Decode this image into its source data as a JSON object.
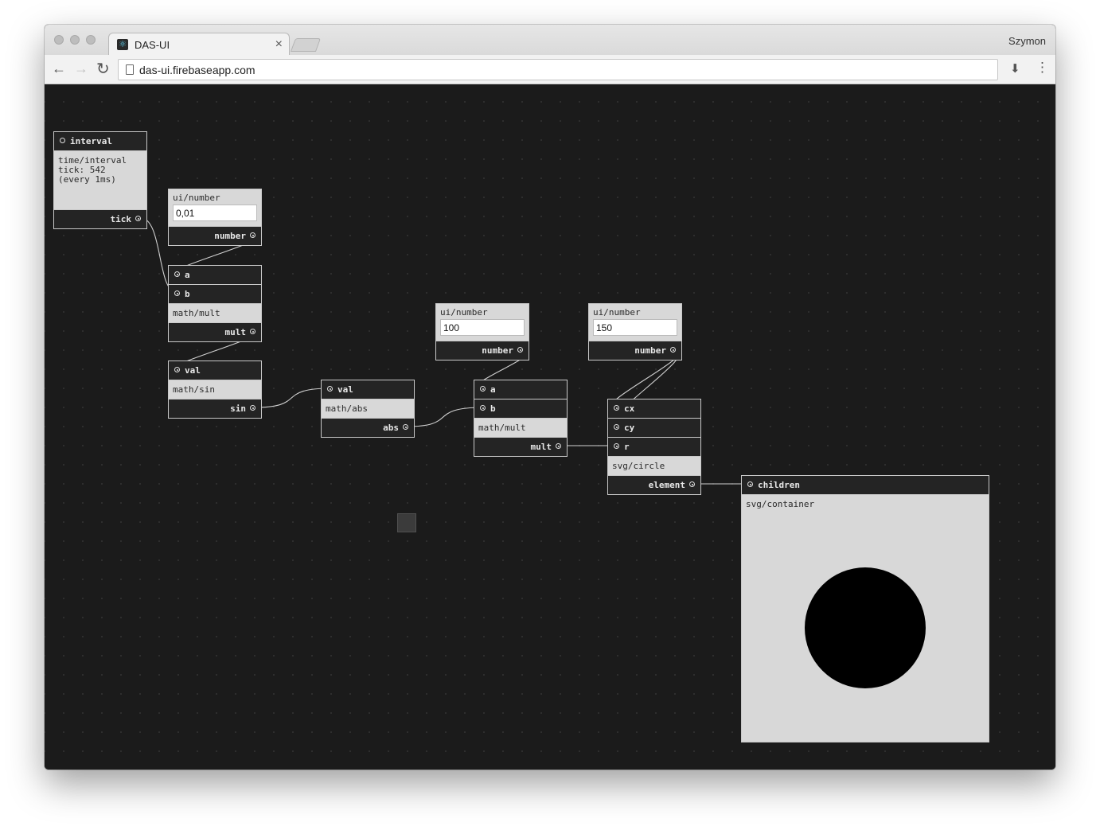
{
  "browser": {
    "tab_title": "DAS-UI",
    "tab_close": "×",
    "profile": "Szymon",
    "url": "das-ui.firebaseapp.com",
    "back": "←",
    "forward": "→",
    "reload": "↻",
    "download": "⬇",
    "menu": "⋮"
  },
  "nodes": {
    "interval": {
      "title": "interval",
      "type": "time/interval",
      "tick_text": "tick: 542",
      "every_text": "(every 1ms)",
      "out": "tick"
    },
    "number1": {
      "type": "ui/number",
      "value": "0,01",
      "out": "number"
    },
    "mult1": {
      "in_a": "a",
      "in_b": "b",
      "type": "math/mult",
      "out": "mult"
    },
    "sin": {
      "in": "val",
      "type": "math/sin",
      "out": "sin"
    },
    "abs": {
      "in": "val",
      "type": "math/abs",
      "out": "abs"
    },
    "number2": {
      "type": "ui/number",
      "value": "100",
      "out": "number"
    },
    "mult2": {
      "in_a": "a",
      "in_b": "b",
      "type": "math/mult",
      "out": "mult"
    },
    "number3": {
      "type": "ui/number",
      "value": "150",
      "out": "number"
    },
    "circle": {
      "in_cx": "cx",
      "in_cy": "cy",
      "in_r": "r",
      "type": "svg/circle",
      "out": "element"
    },
    "container": {
      "in": "children",
      "type": "svg/container"
    }
  },
  "colors": {
    "canvas": "#1b1b1b",
    "node_dark": "#242424",
    "node_light": "#d8d8d8",
    "wire": "#d0d0d0",
    "circle": "#000000"
  }
}
